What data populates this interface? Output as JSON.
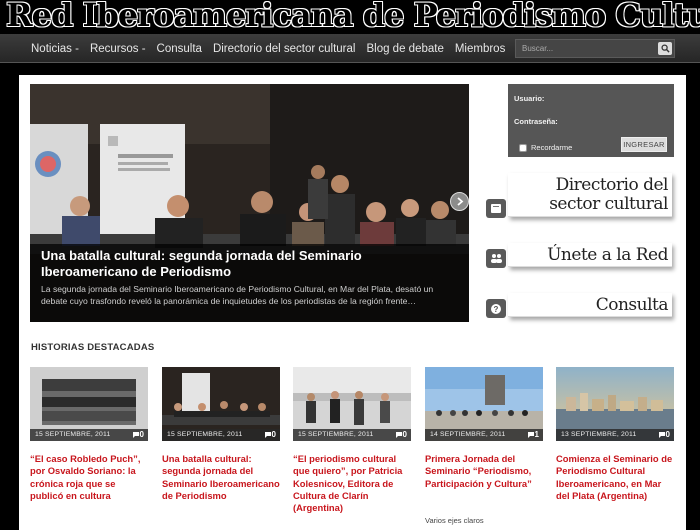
{
  "site": {
    "title": "Red Iberoamericana de Periodismo Cultural"
  },
  "nav": {
    "items": [
      {
        "label": "Noticias -"
      },
      {
        "label": "Recursos -"
      },
      {
        "label": "Consulta"
      },
      {
        "label": "Directorio del sector cultural"
      },
      {
        "label": "Blog de debate"
      },
      {
        "label": "Miembros"
      }
    ],
    "search_placeholder": "Buscar..."
  },
  "featured": {
    "title": "Una batalla cultural: segunda jornada del Seminario Iberoamericano de Periodismo",
    "excerpt": "La segunda jornada del Seminario Iberoamericano de Periodismo Cultural, en Mar del Plata, desató un debate  cuyo trasfondo reveló la panorámica de inquietudes de los periodistas de la región frente…"
  },
  "login": {
    "user_label": "Usuario:",
    "password_label": "Contraseña:",
    "remember_label": "Recordarme",
    "submit_label": "INGRESAR"
  },
  "promos": [
    {
      "label": "Directorio del sector cultural",
      "icon": "book-icon"
    },
    {
      "label": "Únete a la Red",
      "icon": "people-icon"
    },
    {
      "label": "Consulta",
      "icon": "question-icon"
    }
  ],
  "stories_heading": "HISTORIAS DESTACADAS",
  "stories": [
    {
      "date": "15 SEPTIEMBRE, 2011",
      "comments": "0",
      "title": "“El caso Robledo Puch”, por Osvaldo Soriano: la crónica roja que se publicó en cultura",
      "subtitle": ""
    },
    {
      "date": "15 SEPTIEMBRE, 2011",
      "comments": "0",
      "title": "Una batalla cultural: segunda jornada del Seminario Iberoamericano de Periodismo",
      "subtitle": ""
    },
    {
      "date": "15 SEPTIEMBRE, 2011",
      "comments": "0",
      "title": "“El periodismo cultural que quiero”, por Patricia Kolesnicov, Editora de Cultura de Clarín (Argentina)",
      "subtitle": ""
    },
    {
      "date": "14 SEPTIEMBRE, 2011",
      "comments": "1",
      "title": "Primera Jornada del Seminario “Periodismo, Participación y Cultura”",
      "subtitle": "Varios ejes claros"
    },
    {
      "date": "13 SEPTIEMBRE, 2011",
      "comments": "0",
      "title": "Comienza el Seminario de Periodismo Cultural Iberoamericano, en Mar del Plata (Argentina)",
      "subtitle": ""
    }
  ],
  "colors": {
    "accent_red": "#c8161d",
    "nav_bg": "#2e2e2e",
    "login_bg": "#565656"
  }
}
